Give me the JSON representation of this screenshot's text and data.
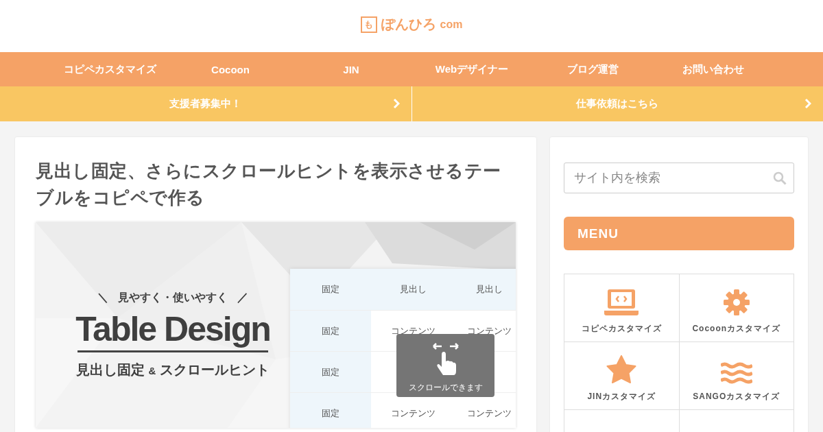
{
  "logo": {
    "mark": "も",
    "name": "ぽんひろ",
    "suffix": "com"
  },
  "nav": [
    {
      "label": "コピペカスタマイズ"
    },
    {
      "label": "Cocoon"
    },
    {
      "label": "JIN"
    },
    {
      "label": "Webデザイナー"
    },
    {
      "label": "ブログ運営"
    },
    {
      "label": "お問い合わせ"
    }
  ],
  "banners": [
    {
      "label": "支援者募集中！"
    },
    {
      "label": "仕事依頼はこちら"
    }
  ],
  "article": {
    "title": "見出し固定、さらにスクロールヒントを表示させるテーブルをコピペで作る",
    "featured_image": {
      "tagline_left": "＼",
      "tagline": "見やすく・使いやすく",
      "tagline_right": "／",
      "heading": "Table Design",
      "subtitle_a": "見出し固定",
      "subtitle_amp": "&",
      "subtitle_b": "スクロールヒント",
      "table": {
        "columns": [
          "固定",
          "見出し",
          "見出し"
        ],
        "rows": [
          [
            "固定",
            "コンテンツ",
            "コンテンツ"
          ],
          [
            "固定",
            null,
            null
          ],
          [
            "固定",
            "コンテンツ",
            "コンテンツ"
          ]
        ]
      },
      "hint": {
        "label": "スクロールできます"
      }
    }
  },
  "sidebar": {
    "search": {
      "placeholder": "サイト内を検索"
    },
    "menu_title": "MENU",
    "menu": [
      {
        "kind": "laptop",
        "label": "コピペカスタマイズ"
      },
      {
        "kind": "gear",
        "label": "Cocoonカスタマイズ"
      },
      {
        "kind": "star",
        "label": "JINカスタマイズ"
      },
      {
        "kind": "waves",
        "label": "SANGOカスタマイズ"
      },
      {
        "kind": "none"
      },
      {
        "kind": "none"
      }
    ]
  }
}
